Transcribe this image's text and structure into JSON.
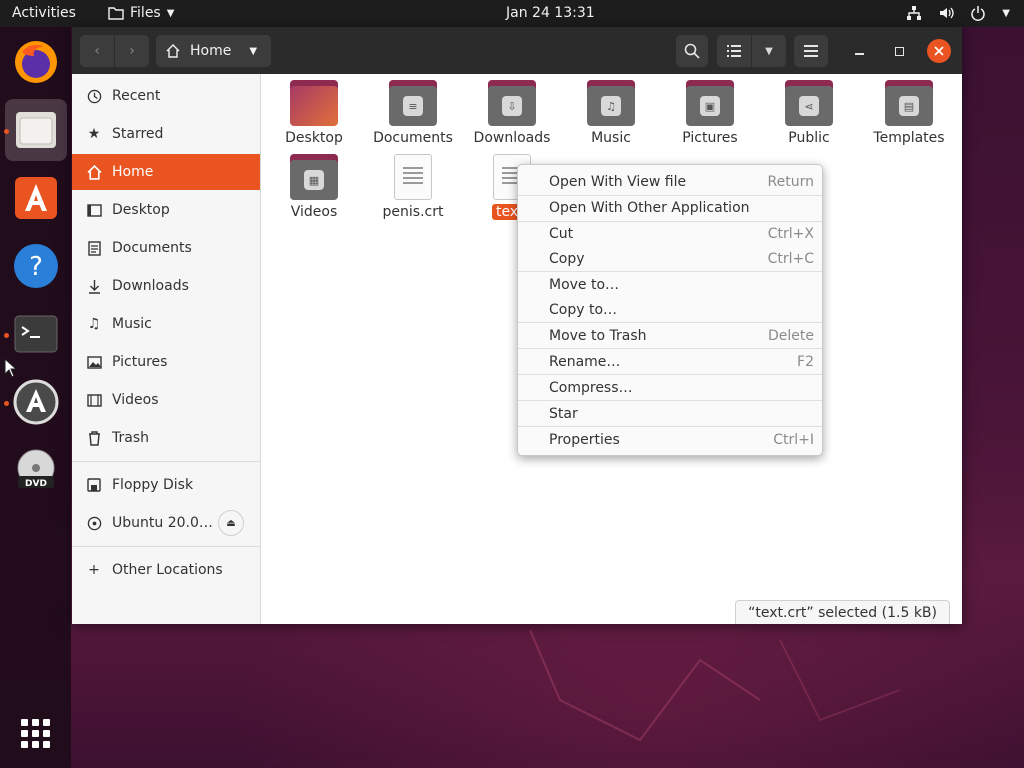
{
  "topbar": {
    "activities": "Activities",
    "app_name": "Files",
    "clock": "Jan 24  13:31"
  },
  "window": {
    "path_label": "Home"
  },
  "sidebar": {
    "items": [
      {
        "label": "Recent",
        "icon": "clock-icon"
      },
      {
        "label": "Starred",
        "icon": "star-icon"
      },
      {
        "label": "Home",
        "icon": "home-icon"
      },
      {
        "label": "Desktop",
        "icon": "desktop-icon"
      },
      {
        "label": "Documents",
        "icon": "document-icon"
      },
      {
        "label": "Downloads",
        "icon": "download-icon"
      },
      {
        "label": "Music",
        "icon": "music-icon"
      },
      {
        "label": "Pictures",
        "icon": "picture-icon"
      },
      {
        "label": "Videos",
        "icon": "video-icon"
      },
      {
        "label": "Trash",
        "icon": "trash-icon"
      }
    ],
    "devices": [
      {
        "label": "Floppy Disk",
        "icon": "floppy-icon"
      },
      {
        "label": "Ubuntu 20.0…",
        "icon": "disc-icon"
      }
    ],
    "other": {
      "label": "Other Locations",
      "icon": "plus-icon"
    }
  },
  "content": {
    "items": [
      {
        "label": "Desktop",
        "type": "folder"
      },
      {
        "label": "Documents",
        "type": "folder"
      },
      {
        "label": "Downloads",
        "type": "folder"
      },
      {
        "label": "Music",
        "type": "folder"
      },
      {
        "label": "Pictures",
        "type": "folder"
      },
      {
        "label": "Public",
        "type": "folder"
      },
      {
        "label": "Templates",
        "type": "folder"
      },
      {
        "label": "Videos",
        "type": "folder"
      },
      {
        "label": "penis.crt",
        "type": "file"
      },
      {
        "label": "text.",
        "type": "file",
        "selected": true
      }
    ],
    "status": "“text.crt” selected  (1.5 kB)"
  },
  "context_menu": {
    "items": [
      {
        "label": "Open With View file",
        "accel": "Return"
      },
      {
        "label": "Open With Other Application",
        "accel": ""
      },
      {
        "label": "Cut",
        "accel": "Ctrl+X"
      },
      {
        "label": "Copy",
        "accel": "Ctrl+C"
      },
      {
        "label": "Move to…",
        "accel": ""
      },
      {
        "label": "Copy to…",
        "accel": ""
      },
      {
        "label": "Move to Trash",
        "accel": "Delete"
      },
      {
        "label": "Rename…",
        "accel": "F2"
      },
      {
        "label": "Compress…",
        "accel": ""
      },
      {
        "label": "Star",
        "accel": ""
      },
      {
        "label": "Properties",
        "accel": "Ctrl+I"
      }
    ]
  },
  "colors": {
    "accent": "#e95420",
    "headerbar": "#2b2b2b",
    "folder_tab": "#8e2a4f"
  }
}
